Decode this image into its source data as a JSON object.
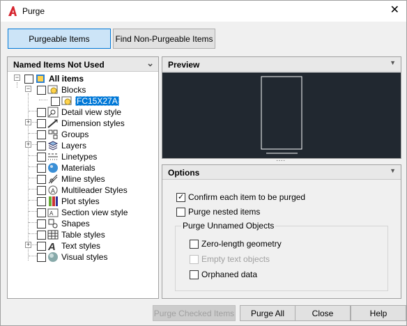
{
  "window": {
    "title": "Purge"
  },
  "tabs": {
    "purgeable": "Purgeable Items",
    "non_purgeable": "Find Non-Purgeable Items"
  },
  "tree_panel": {
    "title": "Named Items Not Used",
    "root": "All items",
    "blocks": "Blocks",
    "block_child": "FC15X27A",
    "items": [
      "Detail view style",
      "Dimension styles",
      "Groups",
      "Layers",
      "Linetypes",
      "Materials",
      "Mline styles",
      "Multileader Styles",
      "Plot styles",
      "Section view style",
      "Shapes",
      "Table styles",
      "Text styles",
      "Visual styles"
    ]
  },
  "preview": {
    "title": "Preview"
  },
  "options": {
    "title": "Options",
    "confirm": "Confirm each item to be purged",
    "nested": "Purge nested items",
    "group_title": "Purge Unnamed Objects",
    "zero_length": "Zero-length geometry",
    "empty_text": "Empty text objects",
    "orphaned": "Orphaned data"
  },
  "buttons": {
    "purge_checked": "Purge Checked Items",
    "purge_all": "Purge All",
    "close": "Close",
    "help": "Help"
  },
  "colors": {
    "accent": "#0078d7",
    "preview_bg": "#212830",
    "selected_bg": "#0078d7"
  }
}
